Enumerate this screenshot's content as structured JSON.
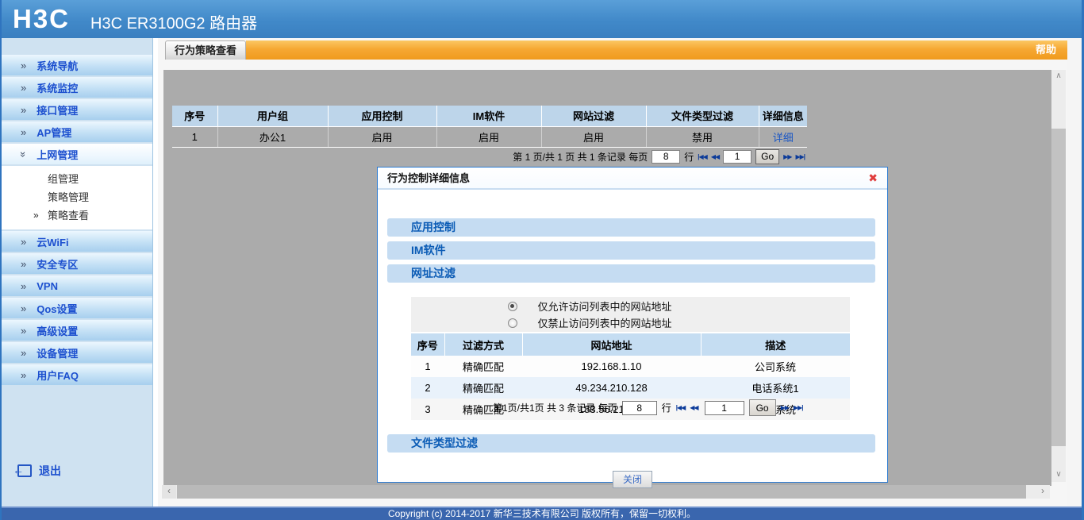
{
  "colors": {
    "header_blue": "#4189c9",
    "tab_orange": "#f6a833",
    "sidebar_text": "#1d50cf",
    "link_blue": "#1a56c4",
    "section_blue": "#0a5bb5",
    "footer_blue": "#3a66ae",
    "close_red": "#e03c3c",
    "content_gray": "#ababab"
  },
  "header": {
    "logo": "H3C",
    "title": "H3C ER3100G2 路由器"
  },
  "tabs": {
    "active": "行为策略查看",
    "help": "帮助"
  },
  "sidebar": {
    "items": [
      {
        "label": "系统导航"
      },
      {
        "label": "系统监控"
      },
      {
        "label": "接口管理"
      },
      {
        "label": "AP管理"
      },
      {
        "label": "上网管理"
      },
      {
        "label": "云WiFi"
      },
      {
        "label": "安全专区"
      },
      {
        "label": "VPN"
      },
      {
        "label": "Qos设置"
      },
      {
        "label": "高级设置"
      },
      {
        "label": "设备管理"
      },
      {
        "label": "用户FAQ"
      }
    ],
    "submenu": [
      {
        "label": "组管理"
      },
      {
        "label": "策略管理"
      },
      {
        "label": "策略查看"
      }
    ],
    "logout": "退出"
  },
  "policy_table": {
    "headers": [
      "序号",
      "用户组",
      "应用控制",
      "IM软件",
      "网站过滤",
      "文件类型过滤",
      "详细信息"
    ],
    "row": [
      "1",
      "办公1",
      "启用",
      "启用",
      "启用",
      "禁用",
      "详细"
    ],
    "pagination": {
      "info": "第 1 页/共 1 页 共 1 条记录 每页",
      "rows_value": "8",
      "rows_suffix": "行",
      "page_value": "1",
      "go": "Go"
    }
  },
  "dialog": {
    "title": "行为控制详细信息",
    "sections": {
      "app": "应用控制",
      "im": "IM软件",
      "url": "网址过滤",
      "file": "文件类型过滤"
    },
    "url_filter": {
      "allow_label": "仅允许访问列表中的网站地址",
      "deny_label": "仅禁止访问列表中的网站地址",
      "headers": [
        "序号",
        "过滤方式",
        "网站地址",
        "描述"
      ],
      "rows": [
        [
          "1",
          "精确匹配",
          "192.168.1.10",
          "公司系统"
        ],
        [
          "2",
          "精确匹配",
          "49.234.210.128",
          "电话系统1"
        ],
        [
          "3",
          "精确匹配",
          "183.56.214.98",
          "充值系统"
        ]
      ],
      "pagination": {
        "info": "第1页/共1页 共 3 条记录 每页",
        "rows_value": "8",
        "rows_suffix": "行",
        "page_value": "1",
        "go": "Go"
      }
    },
    "close_button": "关闭"
  },
  "footer": {
    "copyright": "Copyright (c) 2014-2017 新华三技术有限公司 版权所有，保留一切权利。"
  },
  "icons": {
    "expand": "»",
    "submenu_arrow": "»",
    "logout_arrow": "←",
    "close": "✖",
    "first": "|◀◀",
    "prev": "◀◀",
    "next": "▶▶",
    "last": "▶▶|",
    "scroll_up": "∧",
    "scroll_down": "∨",
    "scroll_left": "‹",
    "scroll_right": "›"
  }
}
